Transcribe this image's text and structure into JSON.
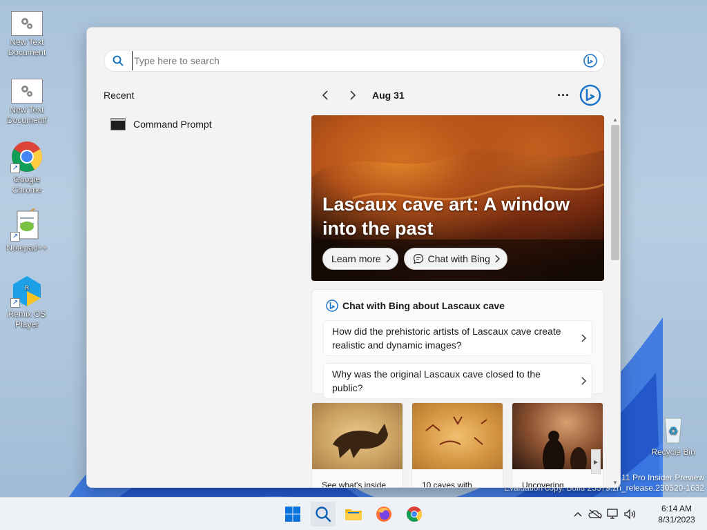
{
  "desktop": {
    "icons": [
      {
        "label": "New Text Document"
      },
      {
        "label": "New Text Documentf"
      },
      {
        "label": "Google Chrome"
      },
      {
        "label": "Notepad++"
      },
      {
        "label": "Remix OS Player"
      },
      {
        "label": "Recycle Bin"
      }
    ],
    "watermark_line1": "11 Pro Insider Preview",
    "watermark_line2": "Evaluation copy. Build 25379.zn_release.230520-1632"
  },
  "search": {
    "placeholder": "Type here to search",
    "value": ""
  },
  "recent": {
    "title": "Recent",
    "items": [
      {
        "label": "Command Prompt",
        "icon": "command-prompt-icon"
      }
    ]
  },
  "highlights": {
    "date": "Aug 31",
    "hero": {
      "title": "Lascaux cave art: A window into the past",
      "learn_more": "Learn more",
      "chat_with_bing": "Chat with Bing"
    },
    "chat_card": {
      "title": "Chat with Bing about Lascaux cave",
      "questions": [
        "How did the prehistoric artists of Lascaux cave create realistic and dynamic images?",
        "Why was the original Lascaux cave closed to the public?"
      ]
    },
    "tiles": [
      {
        "caption": "See what's inside"
      },
      {
        "caption": "10 caves with"
      },
      {
        "caption": "Uncovering"
      }
    ]
  },
  "taskbar": {
    "time": "6:14 AM",
    "date": "8/31/2023"
  },
  "colors": {
    "accent": "#0067c0",
    "panel_bg": "#f3f3f3",
    "bing_blue": "#1a73c8"
  }
}
